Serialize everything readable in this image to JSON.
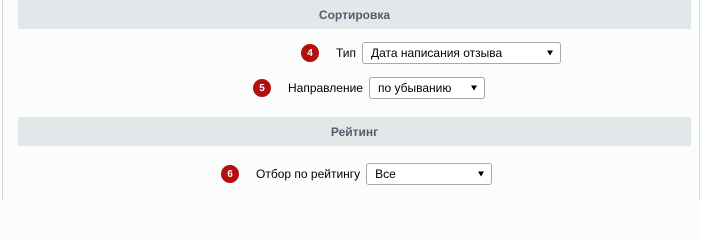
{
  "sections": {
    "sorting": {
      "title": "Сортировка"
    },
    "rating": {
      "title": "Рейтинг"
    }
  },
  "fields": {
    "type": {
      "badge": "4",
      "label": "Тип",
      "selected": "Дата написания отзыва"
    },
    "direction": {
      "badge": "5",
      "label": "Направление",
      "selected": "по убыванию"
    },
    "rating_filter": {
      "badge": "6",
      "label": "Отбор по рейтингу",
      "selected": "Все"
    }
  },
  "colors": {
    "badge": "#b30f0f",
    "header_bg": "#e2e8ea",
    "header_text": "#535c69"
  }
}
